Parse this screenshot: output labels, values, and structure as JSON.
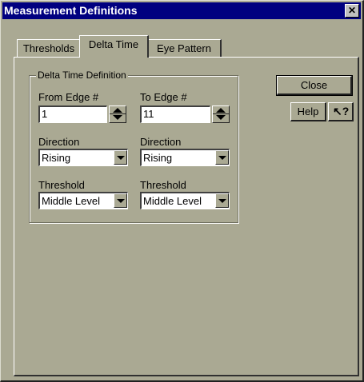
{
  "window": {
    "title": "Measurement Definitions",
    "close_glyph": "✕"
  },
  "tabs": [
    {
      "label": "Thresholds",
      "active": false
    },
    {
      "label": "Delta Time",
      "active": true
    },
    {
      "label": "Eye Pattern",
      "active": false
    }
  ],
  "group": {
    "legend": "Delta Time Definition"
  },
  "from": {
    "edge_label": "From Edge #",
    "edge_value": "1",
    "direction_label": "Direction",
    "direction_value": "Rising",
    "threshold_label": "Threshold",
    "threshold_value": "Middle Level"
  },
  "to": {
    "edge_label": "To Edge #",
    "edge_value": "11",
    "direction_label": "Direction",
    "direction_value": "Rising",
    "threshold_label": "Threshold",
    "threshold_value": "Middle Level"
  },
  "buttons": {
    "close": "Close",
    "help": "Help",
    "whats_this": "↖?"
  },
  "colors": {
    "face": "#aaa993",
    "titlebar": "#000080"
  }
}
